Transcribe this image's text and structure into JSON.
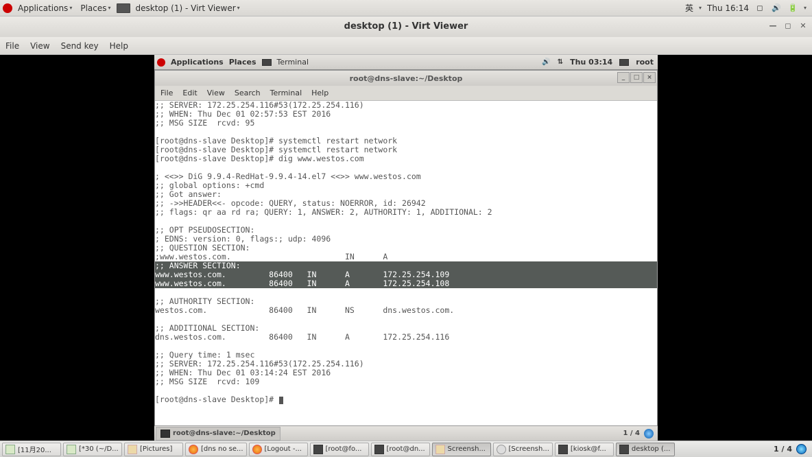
{
  "host_panel": {
    "applications": "Applications",
    "places": "Places",
    "window_menu": "desktop (1) - Virt Viewer",
    "ime": "英",
    "clock": "Thu 16:14"
  },
  "virt_viewer": {
    "title": "desktop (1) - Virt Viewer",
    "menus": {
      "file": "File",
      "view": "View",
      "sendkey": "Send key",
      "help": "Help"
    }
  },
  "guest_panel": {
    "applications": "Applications",
    "places": "Places",
    "task": "Terminal",
    "clock": "Thu 03:14",
    "user": "root"
  },
  "terminal": {
    "title": "root@dns-slave:~/Desktop",
    "menus": {
      "file": "File",
      "edit": "Edit",
      "view": "View",
      "search": "Search",
      "terminal": "Terminal",
      "help": "Help"
    },
    "lines_top": ";; SERVER: 172.25.254.116#53(172.25.254.116)\n;; WHEN: Thu Dec 01 02:57:53 EST 2016\n;; MSG SIZE  rcvd: 95\n\n[root@dns-slave Desktop]# systemctl restart network\n[root@dns-slave Desktop]# systemctl restart network\n[root@dns-slave Desktop]# dig www.westos.com\n\n; <<>> DiG 9.9.4-RedHat-9.9.4-14.el7 <<>> www.westos.com\n;; global options: +cmd\n;; Got answer:\n;; ->>HEADER<<- opcode: QUERY, status: NOERROR, id: 26942\n;; flags: qr aa rd ra; QUERY: 1, ANSWER: 2, AUTHORITY: 1, ADDITIONAL: 2\n\n;; OPT PSEUDOSECTION:\n; EDNS: version: 0, flags:; udp: 4096\n;; QUESTION SECTION:\n;www.westos.com.                        IN      A\n",
    "lines_sel": ";; ANSWER SECTION:\nwww.westos.com.         86400   IN      A       172.25.254.109\nwww.westos.com.         86400   IN      A       172.25.254.108",
    "lines_bottom": "\n;; AUTHORITY SECTION:\nwestos.com.             86400   IN      NS      dns.westos.com.\n\n;; ADDITIONAL SECTION:\ndns.westos.com.         86400   IN      A       172.25.254.116\n\n;; Query time: 1 msec\n;; SERVER: 172.25.254.116#53(172.25.254.116)\n;; WHEN: Thu Dec 01 03:14:24 EST 2016\n;; MSG SIZE  rcvd: 109\n\n",
    "prompt": "[root@dns-slave Desktop]# "
  },
  "guest_taskbar": {
    "tab": "root@dns-slave:~/Desktop",
    "ws": "1 / 4"
  },
  "host_taskbar": {
    "items": [
      "[11月20...",
      "[*30 (~/D...",
      "[Pictures]",
      "[dns no se...",
      "[Logout -...",
      "[root@fo...",
      "[root@dn...",
      "Screensh...",
      "[Screensh...",
      "[kiosk@f...",
      "desktop (..."
    ],
    "ws": "1 / 4"
  }
}
